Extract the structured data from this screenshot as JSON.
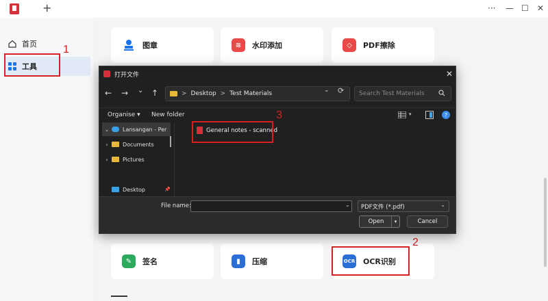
{
  "app": {
    "new_tab_label": "+",
    "window_controls": {
      "more": "···",
      "minimize": "—",
      "maximize": "☐",
      "close": "✕"
    }
  },
  "sidebar": {
    "items": [
      {
        "label": "首页",
        "icon": "home-icon"
      },
      {
        "label": "工具",
        "icon": "grid-icon",
        "active": true
      }
    ]
  },
  "tools": {
    "row1": [
      {
        "label": "图章",
        "icon": "stamp-icon",
        "color": "#1a73e8"
      },
      {
        "label": "水印添加",
        "icon": "watermark-icon",
        "color": "#e84a4a"
      },
      {
        "label": "PDF擦除",
        "icon": "eraser-icon",
        "color": "#e84a4a"
      }
    ],
    "row2": [
      {
        "label": "签名",
        "icon": "signature-icon",
        "color": "#2eaa5c"
      },
      {
        "label": "压缩",
        "icon": "compress-icon",
        "color": "#2b6fd6"
      },
      {
        "label": "OCR识别",
        "icon": "ocr-icon",
        "color": "#2b6fd6",
        "icon_text": "OCR"
      }
    ]
  },
  "annotations": [
    "1",
    "2",
    "3"
  ],
  "dialog": {
    "title": "打开文件",
    "close": "✕",
    "nav": {
      "back": "←",
      "forward": "→",
      "dropdown": "⌄",
      "up": "↑",
      "refresh": "⟳"
    },
    "address": [
      "Desktop",
      "Test Materials"
    ],
    "address_sep": ">",
    "search_placeholder": "Search Test Materials",
    "commands": {
      "organise": "Organise ▾",
      "new_folder": "New folder"
    },
    "tree": [
      {
        "label": "Lansangan - Per",
        "arrow": "⌄",
        "icon_color": "#3aa0e8"
      },
      {
        "label": "Documents",
        "arrow": "›",
        "icon_color": "#e8b83a"
      },
      {
        "label": "Pictures",
        "arrow": "›",
        "icon_color": "#e8b83a"
      },
      {
        "label": "Desktop",
        "arrow": "",
        "icon_color": "#3aa0e8",
        "pin": "📌"
      }
    ],
    "files": [
      {
        "name": "General notes - scanned",
        "type": "pdf"
      }
    ],
    "file_name_label": "File name:",
    "file_name_value": "",
    "file_type": "PDF文件 (*.pdf)",
    "open_label": "Open",
    "cancel_label": "Cancel"
  }
}
